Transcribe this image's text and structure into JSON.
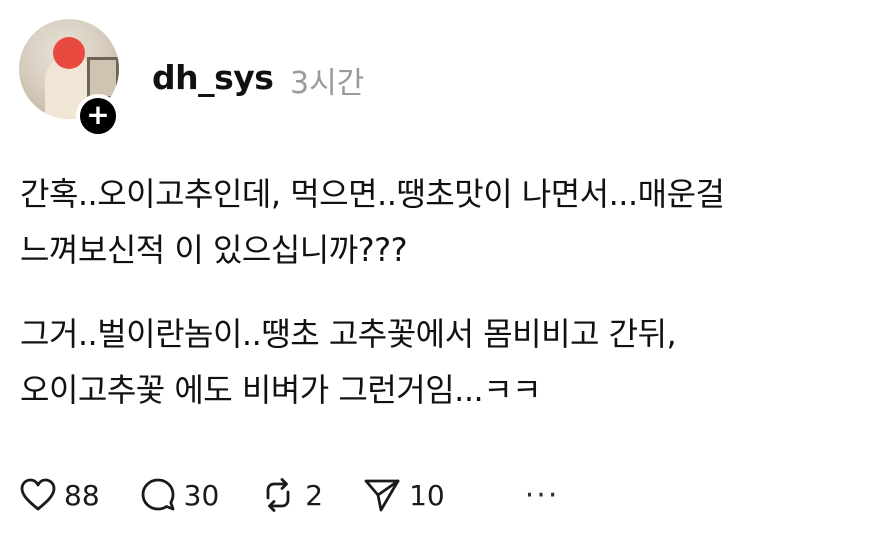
{
  "post": {
    "username": "dh_sys",
    "time": "3시간",
    "follow_symbol": "+",
    "paragraph1_line1": "간혹..오이고추인데, 먹으면..땡초맛이 나면서...매운걸",
    "paragraph1_line2": "느껴보신적 이 있으십니까???",
    "paragraph2_line1": "그거..벌이란놈이..땡초 고추꽃에서 몸비비고 간뒤,",
    "paragraph2_line2": "오이고추꽃 에도 비벼가 그런거임...ㅋㅋ"
  },
  "actions": {
    "likes": "88",
    "replies": "30",
    "reposts": "2",
    "shares": "10",
    "more": "···"
  },
  "icons": [
    "heart-icon",
    "comment-icon",
    "repost-icon",
    "share-icon",
    "more-icon"
  ]
}
